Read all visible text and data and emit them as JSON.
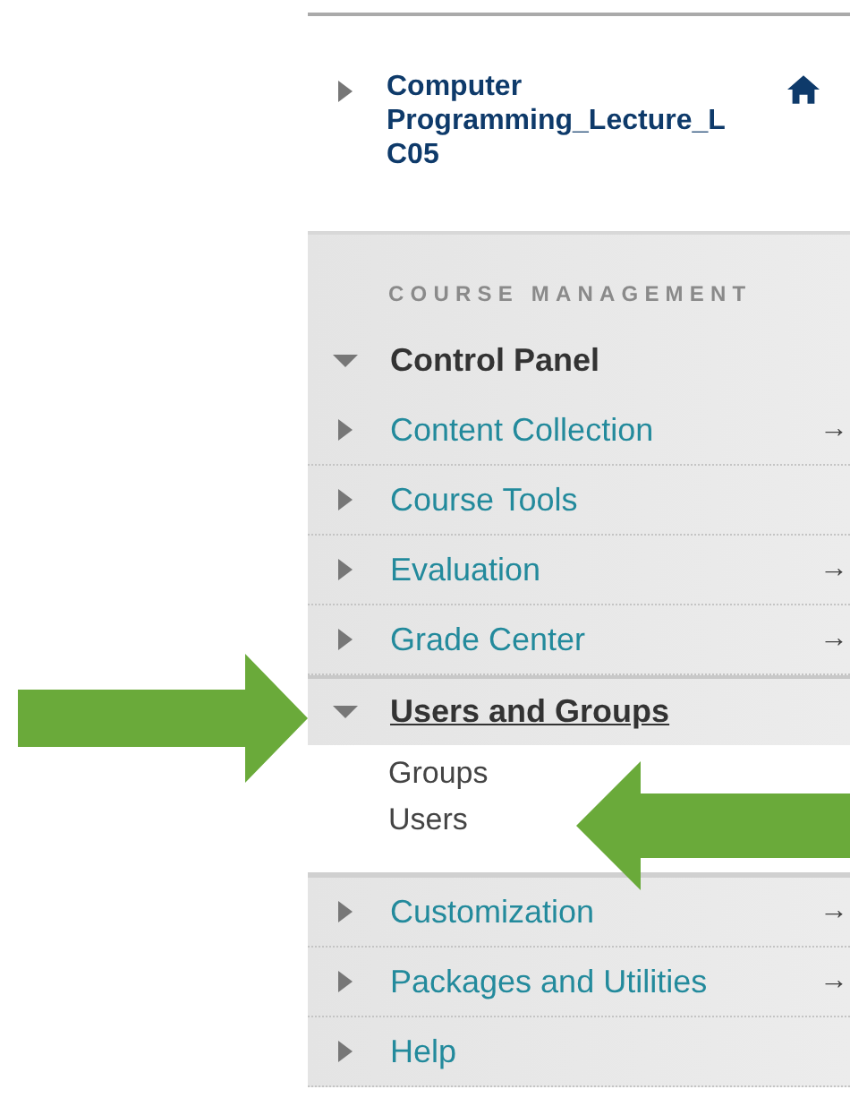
{
  "course": {
    "title": "Computer Programming_Lecture_L C05",
    "expanded": false
  },
  "section_heading": "COURSE MANAGEMENT",
  "panel": {
    "label": "Control Panel",
    "expanded": true
  },
  "items": [
    {
      "label": "Content Collection",
      "expanded": false,
      "selected": false,
      "arrow": "→"
    },
    {
      "label": "Course Tools",
      "expanded": false,
      "selected": false
    },
    {
      "label": "Evaluation",
      "expanded": false,
      "selected": false,
      "arrow": "→"
    },
    {
      "label": "Grade Center",
      "expanded": false,
      "selected": false,
      "arrow": "→"
    },
    {
      "label": "Users and Groups",
      "expanded": true,
      "selected": true,
      "children": [
        {
          "label": "Groups"
        },
        {
          "label": "Users"
        }
      ]
    },
    {
      "label": "Customization",
      "expanded": false,
      "selected": false,
      "arrow": "→"
    },
    {
      "label": "Packages and Utilities",
      "expanded": false,
      "selected": false,
      "arrow": "→"
    },
    {
      "label": "Help",
      "expanded": false,
      "selected": false
    }
  ]
}
